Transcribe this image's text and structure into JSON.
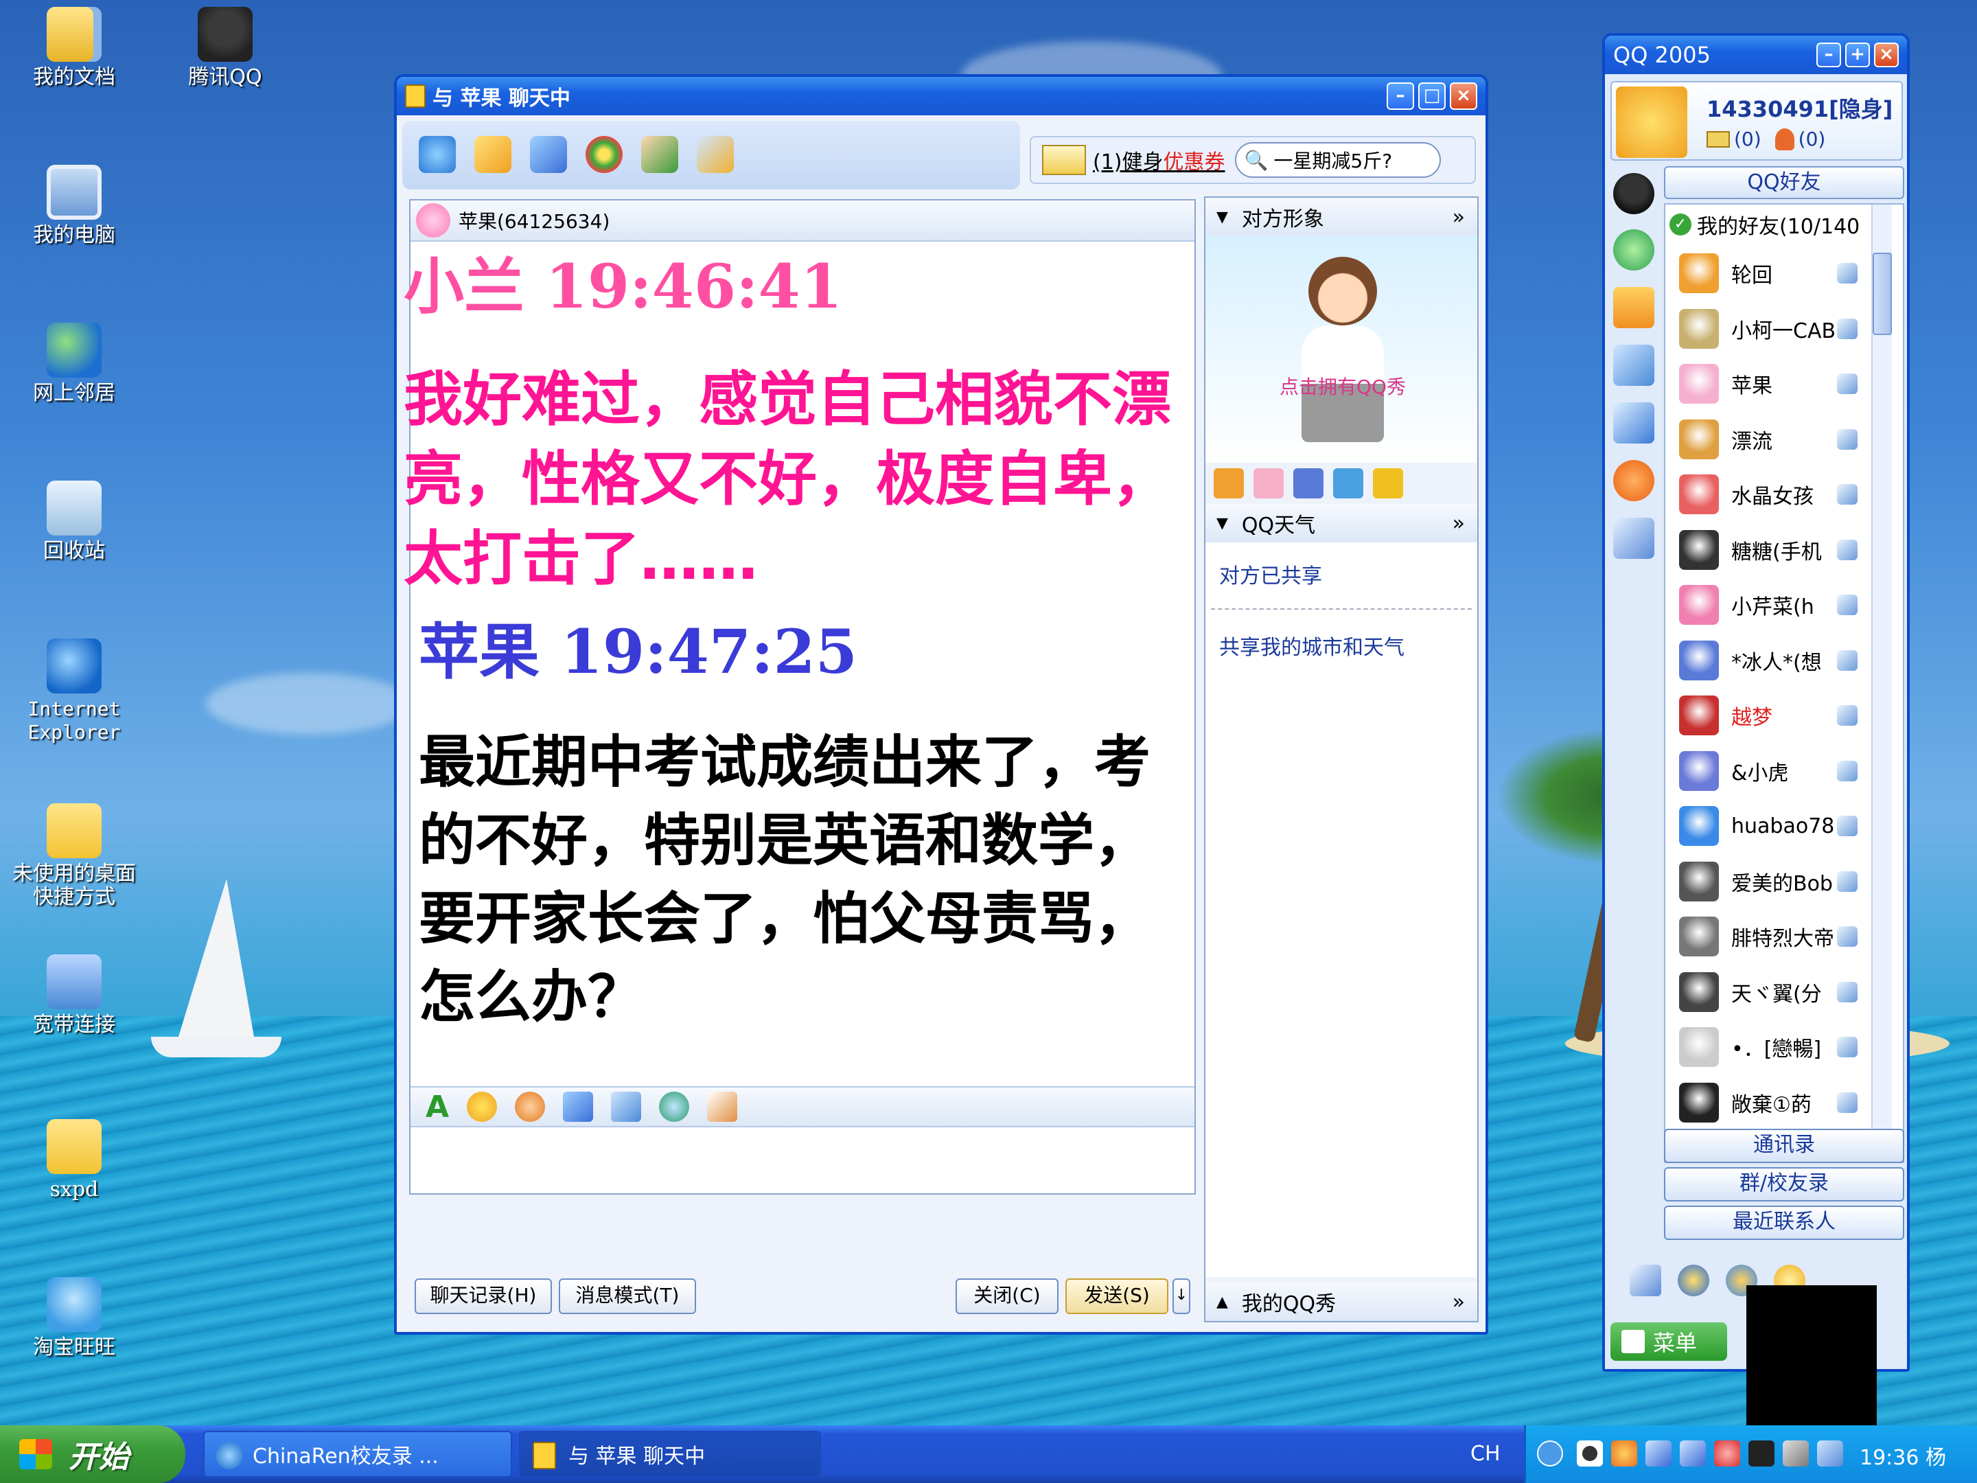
{
  "desktop": {
    "icons": [
      {
        "label": "我的文档"
      },
      {
        "label": "腾讯QQ"
      },
      {
        "label": "我的电脑"
      },
      {
        "label": "网上邻居"
      },
      {
        "label": "回收站"
      },
      {
        "label": "Internet Explorer"
      },
      {
        "label": "未使用的桌面快捷方式"
      },
      {
        "label": "宽带连接"
      },
      {
        "label": "sxpd"
      },
      {
        "label": "淘宝旺旺"
      }
    ]
  },
  "chat_window": {
    "title": "与 苹果 聊天中",
    "ad_text_1": "(1)健身",
    "ad_text_2": "优惠券",
    "search_placeholder": "一星期减5斤?",
    "contact_header": "苹果(64125634)",
    "messages": [
      {
        "sender": "小兰",
        "time": "19:46:41",
        "text": "我好难过，感觉自己相貌不漂亮，性格又不好，极度自卑，太打击了……",
        "color": "#ff4fa2",
        "text_color": "#ff1493"
      },
      {
        "sender": "苹果",
        "time": "19:47:25",
        "text": "最近期中考试成绩出来了，考的不好，特别是英语和数学，要开家长会了，怕父母责骂，怎么办？",
        "color": "#3b3bd8",
        "text_color": "#000000"
      }
    ],
    "side_panel": {
      "avatar_header": "对方形象",
      "qqshow_link": "点击拥有QQ秀",
      "weather_header": "QQ天气",
      "weather_shared": "对方已共享",
      "share_city": "共享我的城市和天气",
      "my_qqshow": "我的QQ秀"
    },
    "buttons": {
      "history": "聊天记录(H)",
      "msg_mode": "消息模式(T)",
      "close": "关闭(C)",
      "send": "发送(S)"
    }
  },
  "qq_main": {
    "title": "QQ 2005",
    "account": "14330491[隐身]",
    "mail_count": "(0)",
    "friend_req_count": "(0)",
    "tab_friends": "QQ好友",
    "group_header": "我的好友(10/140",
    "friends": [
      {
        "name": "轮回",
        "color": "#000000"
      },
      {
        "name": "小柯一CABL",
        "color": "#000000"
      },
      {
        "name": "苹果",
        "color": "#000000"
      },
      {
        "name": "漂流",
        "color": "#000000"
      },
      {
        "name": "水晶女孩",
        "color": "#000000"
      },
      {
        "name": "糖糖(手机",
        "color": "#000000"
      },
      {
        "name": "小芹菜(h",
        "color": "#000000"
      },
      {
        "name": "*冰人*(想",
        "color": "#000000"
      },
      {
        "name": "越梦",
        "color": "#e0201c"
      },
      {
        "name": "&小虎",
        "color": "#000000"
      },
      {
        "name": "huabao78",
        "color": "#000000"
      },
      {
        "name": "爱美的Bob",
        "color": "#000000"
      },
      {
        "name": "腓特烈大帝",
        "color": "#000000"
      },
      {
        "name": "天ヾ翼(分",
        "color": "#000000"
      },
      {
        "name": "•．[戀暢]",
        "color": "#000000"
      },
      {
        "name": "敞棄①菂",
        "color": "#000000"
      }
    ],
    "bottom_tabs": [
      "通讯录",
      "群/校友录",
      "最近联系人"
    ],
    "menu_label": "菜单"
  },
  "taskbar": {
    "start_label": "开始",
    "tasks": [
      {
        "label": "ChinaRen校友录 ..."
      },
      {
        "label": "与 苹果 聊天中"
      }
    ],
    "lang": "CH",
    "clock": "19:36 杨"
  }
}
